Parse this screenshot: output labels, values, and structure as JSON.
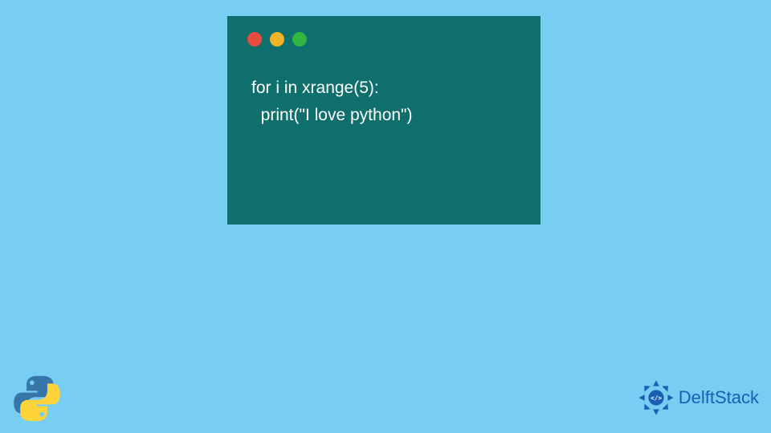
{
  "code": {
    "line1": "for i in xrange(5):",
    "line2": "  print(\"I love python\")"
  },
  "brand": {
    "name": "DelftStack"
  },
  "colors": {
    "background": "#78cdf2",
    "window": "#0e6f6c",
    "red": "#e94b3c",
    "yellow": "#f0b429",
    "green": "#32b643",
    "brand": "#1a5fb4"
  }
}
